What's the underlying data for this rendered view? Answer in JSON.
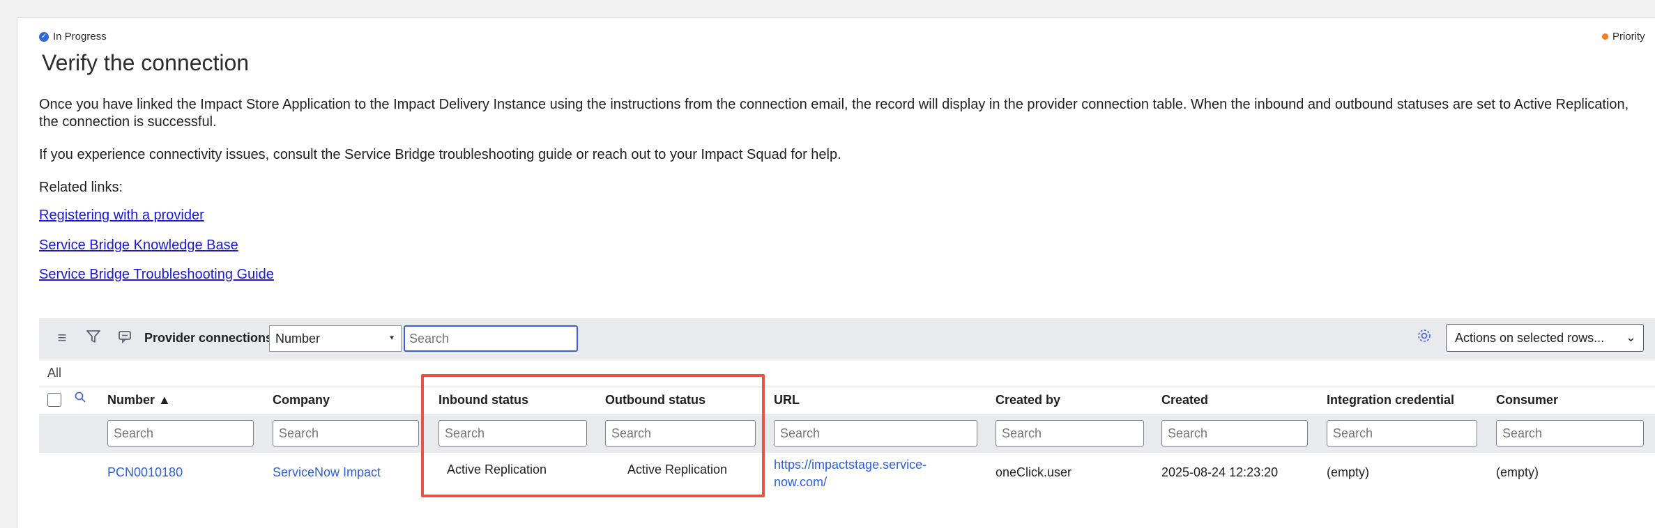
{
  "header": {
    "state_label": "In Progress",
    "priority_label": "Priority",
    "title": "Verify the connection"
  },
  "content": {
    "paragraph_1": "Once you have linked the Impact Store Application to the Impact Delivery Instance using the instructions from the connection email, the record will display in the provider connection table. When the inbound and outbound statuses are set to Active Replication, the connection is successful.",
    "paragraph_2": "If you experience connectivity issues, consult the Service Bridge troubleshooting guide or reach out to your Impact Squad for help.",
    "related_label": "Related links:",
    "links": [
      "Registering with a provider",
      "Service Bridge Knowledge Base",
      "Service Bridge Troubleshooting Guide"
    ]
  },
  "list": {
    "title": "Provider connections",
    "field_select": "Number",
    "search_placeholder": "Search",
    "actions_label": "Actions on selected rows...",
    "breadcrumb": "All",
    "columns": [
      "Number ▲",
      "Company",
      "Inbound status",
      "Outbound status",
      "URL",
      "Created by",
      "Created",
      "Integration credential",
      "Consumer"
    ],
    "filter_placeholder": "Search",
    "rows": [
      {
        "number": "PCN0010180",
        "company": "ServiceNow Impact",
        "inbound_status": "Active Replication",
        "outbound_status": "Active Replication",
        "url": "https://impactstage.service-now.com/",
        "created_by": "oneClick.user",
        "created": "2025-08-24 12:23:20",
        "integration_credential": "(empty)",
        "consumer": "(empty)"
      }
    ]
  },
  "icons": {
    "state": "in-progress-icon",
    "menu": "hamburger-icon",
    "filter": "filter-icon",
    "comment": "comment-icon",
    "gear": "gear-icon",
    "search": "search-icon"
  },
  "colors": {
    "link": "#1a18d6",
    "record_link": "#2b5fd9",
    "highlight": "#e35647",
    "state": "#3168d9",
    "priority_dot": "#f57c1f"
  }
}
